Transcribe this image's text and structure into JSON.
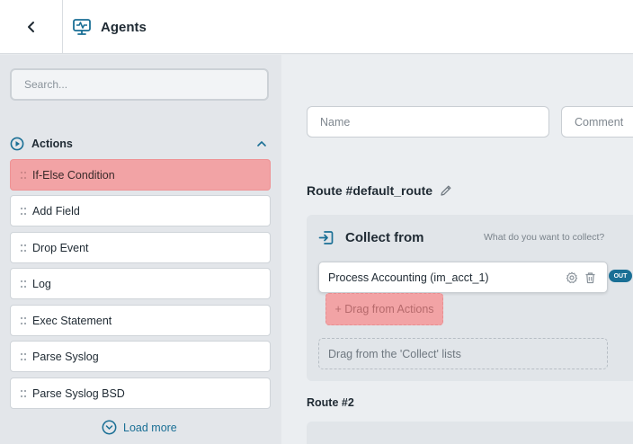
{
  "header": {
    "title": "Agents"
  },
  "sidebar": {
    "search_placeholder": "Search...",
    "section_label": "Actions",
    "items": [
      {
        "label": "If-Else Condition",
        "highlighted": true
      },
      {
        "label": "Add Field"
      },
      {
        "label": "Drop Event"
      },
      {
        "label": "Log"
      },
      {
        "label": "Exec Statement"
      },
      {
        "label": "Parse Syslog"
      },
      {
        "label": "Parse Syslog BSD"
      }
    ],
    "load_more": "Load more"
  },
  "main": {
    "name_placeholder": "Name",
    "comment_placeholder": "Comment",
    "route_title": "Route #default_route",
    "collect_title": "Collect from",
    "collect_hint": "What do you want to collect?",
    "source_label": "Process Accounting (im_acct_1)",
    "out_badge": "OUT",
    "drag_actions": "+ Drag from Actions",
    "drag_collect": "Drag from the 'Collect' lists",
    "route2_title": "Route #2"
  },
  "colors": {
    "accent": "#1a6f95",
    "highlight": "#f2a3a5",
    "sidebar_bg": "#e3e6ea",
    "main_bg": "#ebeef1"
  }
}
